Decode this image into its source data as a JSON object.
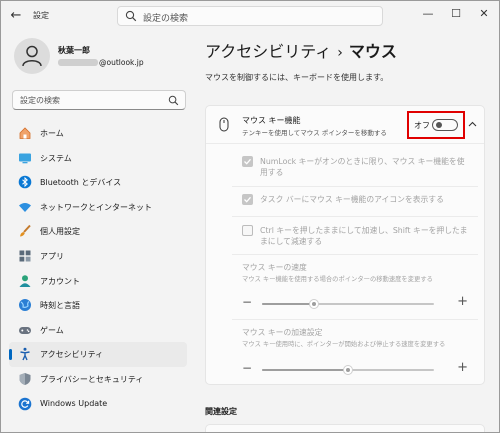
{
  "titlebar": {
    "title": "設定",
    "search_placeholder": "設定の検索",
    "min": "—",
    "max": "☐",
    "close": "✕"
  },
  "user": {
    "name": "秋葉一郎",
    "email_domain": "@outlook.jp"
  },
  "sidebar": {
    "search_placeholder": "設定の検索",
    "items": [
      {
        "label": "ホーム",
        "icon": "home-icon"
      },
      {
        "label": "システム",
        "icon": "monitor-icon"
      },
      {
        "label": "Bluetooth とデバイス",
        "icon": "bluetooth-icon"
      },
      {
        "label": "ネットワークとインターネット",
        "icon": "wifi-icon"
      },
      {
        "label": "個人用設定",
        "icon": "brush-icon"
      },
      {
        "label": "アプリ",
        "icon": "apps-icon"
      },
      {
        "label": "アカウント",
        "icon": "person-icon"
      },
      {
        "label": "時刻と言語",
        "icon": "globe-icon"
      },
      {
        "label": "ゲーム",
        "icon": "gamepad-icon"
      },
      {
        "label": "アクセシビリティ",
        "icon": "accessibility-icon",
        "active": true
      },
      {
        "label": "プライバシーとセキュリティ",
        "icon": "shield-icon"
      },
      {
        "label": "Windows Update",
        "icon": "update-icon"
      }
    ]
  },
  "main": {
    "breadcrumb_parent": "アクセシビリティ",
    "breadcrumb_sep": "›",
    "breadcrumb_current": "マウス",
    "intro": "マウスを制御するには、キーボードを使用します。",
    "mouse_keys": {
      "title": "マウス キー機能",
      "desc": "テンキーを使用してマウス ポインターを移動する",
      "state": "オフ",
      "enabled": false
    },
    "options": [
      {
        "label": "NumLock キーがオンのときに限り、マウス キー機能を使用する",
        "checked": true
      },
      {
        "label": "タスク バーにマウス キー機能のアイコンを表示する",
        "checked": true
      },
      {
        "label": "Ctrl キーを押したままにして加速し、Shift キーを押したままにして減速する",
        "checked": false
      }
    ],
    "speed": {
      "title": "マウス キーの速度",
      "desc": "マウス キー機能を使用する場合のポインターの移動速度を変更する",
      "minus": "−",
      "plus": "+",
      "level": 0.3
    },
    "accel": {
      "title": "マウス キーの加速設定",
      "desc": "マウス キー使用時に、ポインターが開始および停止する速度を変更する",
      "minus": "−",
      "plus": "+",
      "level": 0.5
    }
  },
  "related": {
    "title": "関連設定"
  }
}
